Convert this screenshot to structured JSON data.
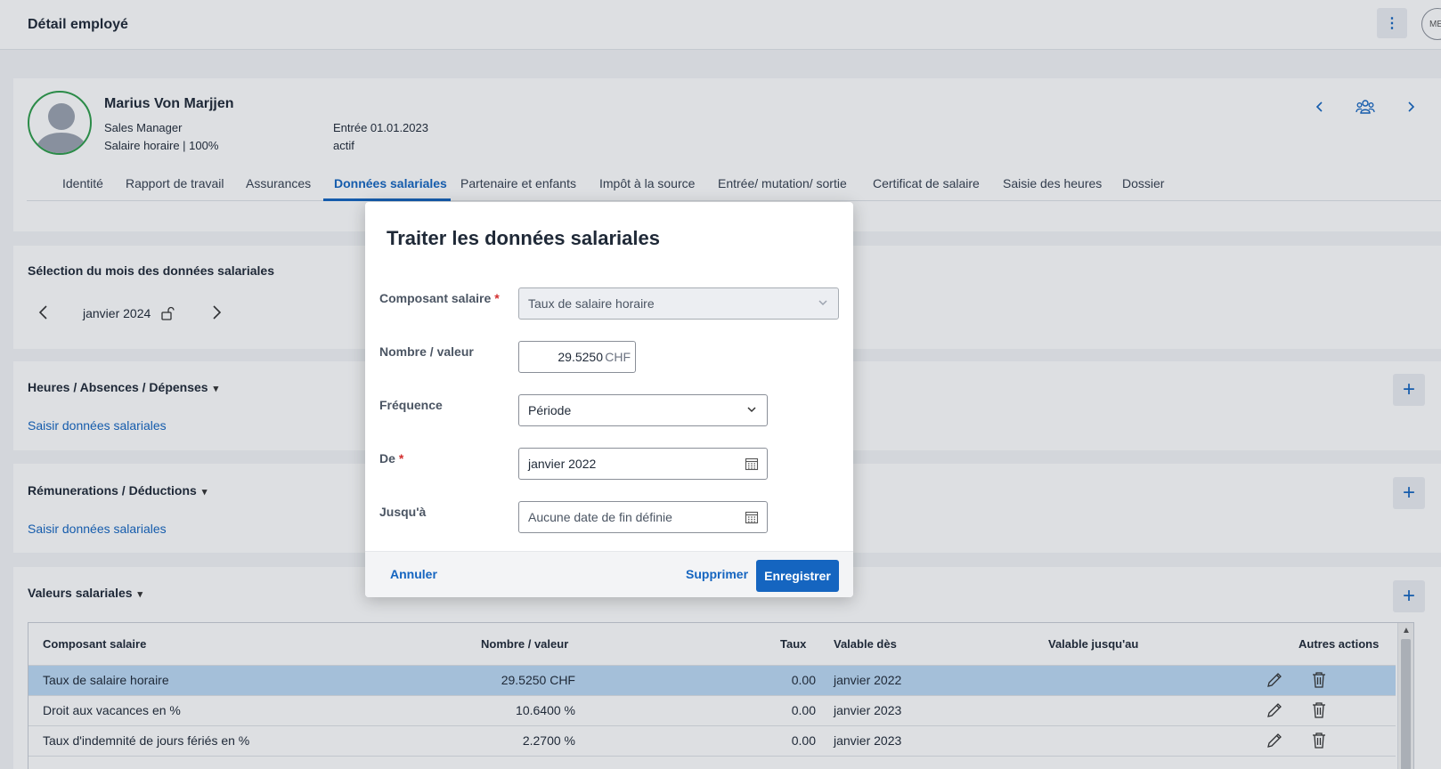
{
  "header": {
    "title": "Détail employé",
    "more_icon": "kebab-icon",
    "user_initials": "ME"
  },
  "employee": {
    "name": "Marius Von Marjjen",
    "role": "Sales Manager",
    "salary_type": "Salaire horaire | 100%",
    "entry": "Entrée 01.01.2023",
    "status": "actif"
  },
  "tabs": [
    {
      "label": "Identité"
    },
    {
      "label": "Rapport de travail"
    },
    {
      "label": "Assurances"
    },
    {
      "label": "Données salariales"
    },
    {
      "label": "Partenaire et enfants"
    },
    {
      "label": "Impôt à la source"
    },
    {
      "label": "Entrée/ mutation/ sortie"
    },
    {
      "label": "Certificat de salaire"
    },
    {
      "label": "Saisie des heures"
    },
    {
      "label": "Dossier"
    }
  ],
  "active_tab": "Données salariales",
  "month_selection": {
    "title": "Sélection du mois des données salariales",
    "month": "janvier 2024"
  },
  "sections": {
    "hours": {
      "title": "Heures / Absences / Dépenses",
      "link": "Saisir données salariales"
    },
    "remuneration": {
      "title": "Rémunerations / Déductions",
      "link": "Saisir données salariales"
    },
    "values": {
      "title": "Valeurs salariales"
    }
  },
  "table": {
    "headers": {
      "component": "Composant salaire",
      "value": "Nombre / valeur",
      "rate": "Taux",
      "valid_from": "Valable dès",
      "valid_until": "Valable jusqu'au",
      "actions": "Autres actions"
    },
    "rows": [
      {
        "component": "Taux de salaire horaire",
        "value": "29.5250 CHF",
        "rate": "0.00",
        "valid_from": "janvier 2022",
        "valid_until": ""
      },
      {
        "component": "Droit aux vacances en %",
        "value": "10.6400 %",
        "rate": "0.00",
        "valid_from": "janvier 2023",
        "valid_until": ""
      },
      {
        "component": "Taux d'indemnité de jours fériés en %",
        "value": "2.2700 %",
        "rate": "0.00",
        "valid_from": "janvier 2023",
        "valid_until": ""
      }
    ]
  },
  "modal": {
    "title": "Traiter les données salariales",
    "fields": {
      "component": {
        "label": "Composant salaire",
        "required": "*",
        "value": "Taux de salaire horaire"
      },
      "amount": {
        "label": "Nombre / valeur",
        "value": "29.5250",
        "unit": "CHF"
      },
      "frequency": {
        "label": "Fréquence",
        "value": "Période"
      },
      "from": {
        "label": "De",
        "required": "*",
        "value": "janvier 2022"
      },
      "until": {
        "label": "Jusqu'à",
        "placeholder": "Aucune date de fin définie"
      }
    },
    "buttons": {
      "cancel": "Annuler",
      "delete": "Supprimer",
      "save": "Enregistrer"
    }
  },
  "colors": {
    "accent": "#1565c0",
    "selected_row": "#bcdaf5",
    "avatar_ring": "#2e9d4b",
    "required": "#d32f2f"
  }
}
